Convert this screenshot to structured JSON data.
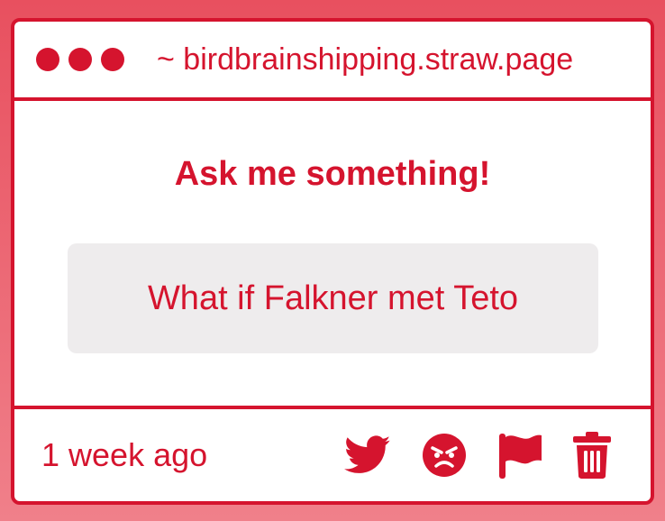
{
  "window": {
    "dots": [
      "window-dot",
      "window-dot",
      "window-dot"
    ],
    "url": "~ birdbrainshipping.straw.page"
  },
  "main": {
    "heading": "Ask me something!",
    "question": "What if Falkner met Teto"
  },
  "footer": {
    "timestamp": "1 week ago",
    "icons": [
      "twitter-icon",
      "angry-face-icon",
      "flag-icon",
      "trash-icon"
    ]
  },
  "colors": {
    "accent": "#d5142e",
    "background": "#e8505f",
    "card": "#ffffff",
    "question_bg": "#eeeced"
  }
}
